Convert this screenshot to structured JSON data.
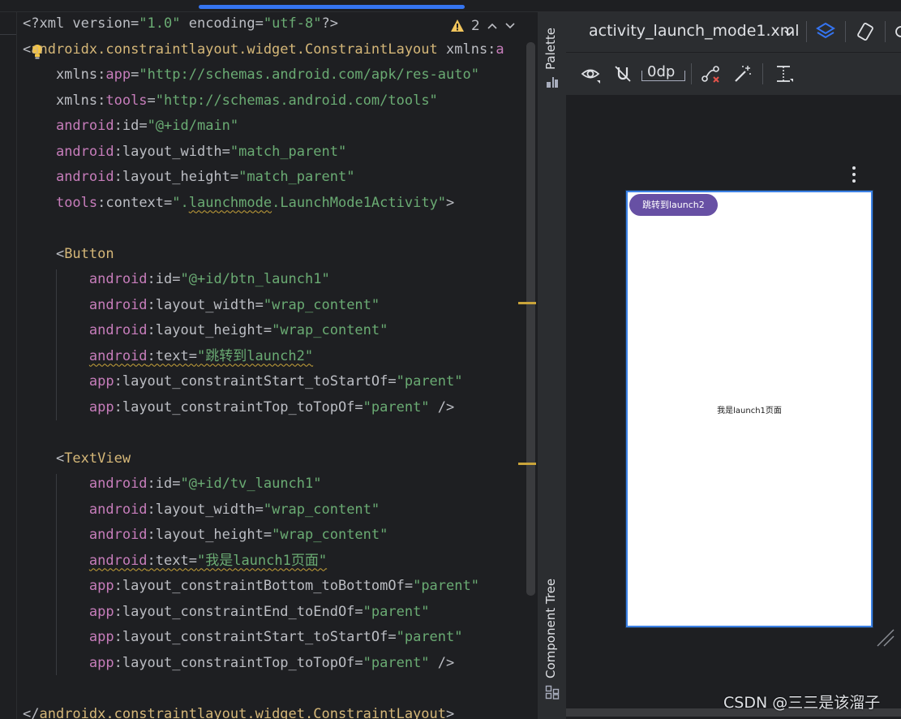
{
  "editor": {
    "lines": [
      [
        {
          "t": "<?xml version=",
          "c": "c-p"
        },
        {
          "t": "\"1.0\"",
          "c": "c-str"
        },
        {
          "t": " encoding=",
          "c": "c-p"
        },
        {
          "t": "\"utf-8\"",
          "c": "c-str"
        },
        {
          "t": "?>",
          "c": "c-p"
        }
      ],
      [
        {
          "t": "<",
          "c": "c-p"
        },
        {
          "t": "androidx.constraintlayout.widget.ConstraintLayout",
          "c": "c-tag"
        },
        {
          "t": " xmlns:",
          "c": "c-attr"
        },
        {
          "t": "a",
          "c": "c-ns"
        }
      ],
      [
        {
          "t": "    xmlns:",
          "c": "c-attr"
        },
        {
          "t": "app",
          "c": "c-ns"
        },
        {
          "t": "=",
          "c": "c-p"
        },
        {
          "t": "\"http://schemas.android.com/apk/res-auto\"",
          "c": "c-str"
        }
      ],
      [
        {
          "t": "    xmlns:",
          "c": "c-attr"
        },
        {
          "t": "tools",
          "c": "c-ns"
        },
        {
          "t": "=",
          "c": "c-p"
        },
        {
          "t": "\"http://schemas.android.com/tools\"",
          "c": "c-str"
        }
      ],
      [
        {
          "t": "    ",
          "c": "c-p"
        },
        {
          "t": "android",
          "c": "c-ns"
        },
        {
          "t": ":id=",
          "c": "c-attr"
        },
        {
          "t": "\"@+id/main\"",
          "c": "c-str"
        }
      ],
      [
        {
          "t": "    ",
          "c": "c-p"
        },
        {
          "t": "android",
          "c": "c-ns"
        },
        {
          "t": ":layout_width=",
          "c": "c-attr"
        },
        {
          "t": "\"match_parent\"",
          "c": "c-str"
        }
      ],
      [
        {
          "t": "    ",
          "c": "c-p"
        },
        {
          "t": "android",
          "c": "c-ns"
        },
        {
          "t": ":layout_height=",
          "c": "c-attr"
        },
        {
          "t": "\"match_parent\"",
          "c": "c-str"
        }
      ],
      [
        {
          "t": "    ",
          "c": "c-p"
        },
        {
          "t": "tools",
          "c": "c-ns"
        },
        {
          "t": ":context=",
          "c": "c-attr"
        },
        {
          "t": "\".",
          "c": "c-str"
        },
        {
          "t": "launchmode",
          "c": "c-str squig"
        },
        {
          "t": ".LaunchMode1Activity\"",
          "c": "c-str"
        },
        {
          "t": ">",
          "c": "c-p"
        }
      ],
      [
        {
          "t": "",
          "c": "c-p"
        }
      ],
      [
        {
          "t": "    <",
          "c": "c-p"
        },
        {
          "t": "Button",
          "c": "c-tag"
        }
      ],
      [
        {
          "t": "        ",
          "c": "c-p"
        },
        {
          "t": "android",
          "c": "c-ns"
        },
        {
          "t": ":id=",
          "c": "c-attr"
        },
        {
          "t": "\"@+id/btn_launch1\"",
          "c": "c-str"
        }
      ],
      [
        {
          "t": "        ",
          "c": "c-p"
        },
        {
          "t": "android",
          "c": "c-ns"
        },
        {
          "t": ":layout_width=",
          "c": "c-attr"
        },
        {
          "t": "\"wrap_content\"",
          "c": "c-str"
        }
      ],
      [
        {
          "t": "        ",
          "c": "c-p"
        },
        {
          "t": "android",
          "c": "c-ns"
        },
        {
          "t": ":layout_height=",
          "c": "c-attr"
        },
        {
          "t": "\"wrap_content\"",
          "c": "c-str"
        }
      ],
      [
        {
          "t": "        ",
          "c": "c-p"
        },
        {
          "t": "android",
          "c": "c-ns squig"
        },
        {
          "t": ":text=",
          "c": "c-attr squig"
        },
        {
          "t": "\"跳转到launch2\"",
          "c": "c-str squig"
        }
      ],
      [
        {
          "t": "        ",
          "c": "c-p"
        },
        {
          "t": "app",
          "c": "c-ns"
        },
        {
          "t": ":layout_constraintStart_toStartOf=",
          "c": "c-attr"
        },
        {
          "t": "\"parent\"",
          "c": "c-str"
        }
      ],
      [
        {
          "t": "        ",
          "c": "c-p"
        },
        {
          "t": "app",
          "c": "c-ns"
        },
        {
          "t": ":layout_constraintTop_toTopOf=",
          "c": "c-attr"
        },
        {
          "t": "\"parent\"",
          "c": "c-str"
        },
        {
          "t": " />",
          "c": "c-p"
        }
      ],
      [
        {
          "t": "",
          "c": "c-p"
        }
      ],
      [
        {
          "t": "    <",
          "c": "c-p"
        },
        {
          "t": "TextView",
          "c": "c-tag"
        }
      ],
      [
        {
          "t": "        ",
          "c": "c-p"
        },
        {
          "t": "android",
          "c": "c-ns"
        },
        {
          "t": ":id=",
          "c": "c-attr"
        },
        {
          "t": "\"@+id/tv_launch1\"",
          "c": "c-str"
        }
      ],
      [
        {
          "t": "        ",
          "c": "c-p"
        },
        {
          "t": "android",
          "c": "c-ns"
        },
        {
          "t": ":layout_width=",
          "c": "c-attr"
        },
        {
          "t": "\"wrap_content\"",
          "c": "c-str"
        }
      ],
      [
        {
          "t": "        ",
          "c": "c-p"
        },
        {
          "t": "android",
          "c": "c-ns"
        },
        {
          "t": ":layout_height=",
          "c": "c-attr"
        },
        {
          "t": "\"wrap_content\"",
          "c": "c-str"
        }
      ],
      [
        {
          "t": "        ",
          "c": "c-p"
        },
        {
          "t": "android",
          "c": "c-ns squig"
        },
        {
          "t": ":text=",
          "c": "c-attr squig"
        },
        {
          "t": "\"我是launch1页面\"",
          "c": "c-str squig"
        }
      ],
      [
        {
          "t": "        ",
          "c": "c-p"
        },
        {
          "t": "app",
          "c": "c-ns"
        },
        {
          "t": ":layout_constraintBottom_toBottomOf=",
          "c": "c-attr"
        },
        {
          "t": "\"parent\"",
          "c": "c-str"
        }
      ],
      [
        {
          "t": "        ",
          "c": "c-p"
        },
        {
          "t": "app",
          "c": "c-ns"
        },
        {
          "t": ":layout_constraintEnd_toEndOf=",
          "c": "c-attr"
        },
        {
          "t": "\"parent\"",
          "c": "c-str"
        }
      ],
      [
        {
          "t": "        ",
          "c": "c-p"
        },
        {
          "t": "app",
          "c": "c-ns"
        },
        {
          "t": ":layout_constraintStart_toStartOf=",
          "c": "c-attr"
        },
        {
          "t": "\"parent\"",
          "c": "c-str"
        }
      ],
      [
        {
          "t": "        ",
          "c": "c-p"
        },
        {
          "t": "app",
          "c": "c-ns"
        },
        {
          "t": ":layout_constraintTop_toTopOf=",
          "c": "c-attr"
        },
        {
          "t": "\"parent\"",
          "c": "c-str"
        },
        {
          "t": " />",
          "c": "c-p"
        }
      ],
      [
        {
          "t": "",
          "c": "c-p"
        }
      ],
      [
        {
          "t": "</",
          "c": "c-p"
        },
        {
          "t": "androidx.constraintlayout",
          "c": "c-tag"
        },
        {
          "t": ".widget.ConstraintLayout",
          "c": "c-tag"
        },
        {
          "t": ">",
          "c": "c-p"
        }
      ]
    ],
    "problems": {
      "warning_count": "2",
      "up": "^",
      "down": "v"
    }
  },
  "side_strip": {
    "palette_label": "Palette",
    "component_tree_label": "Component Tree"
  },
  "design": {
    "file_name": "activity_launch_mode1.xml",
    "dp_value": "0dp",
    "preview": {
      "button_text": "跳转到launch2",
      "center_text": "我是launch1页面"
    }
  },
  "watermark": "CSDN @三三是该溜子",
  "colors": {
    "accent": "#3574f0",
    "button": "#6750a4",
    "warning": "#c9a43a"
  }
}
